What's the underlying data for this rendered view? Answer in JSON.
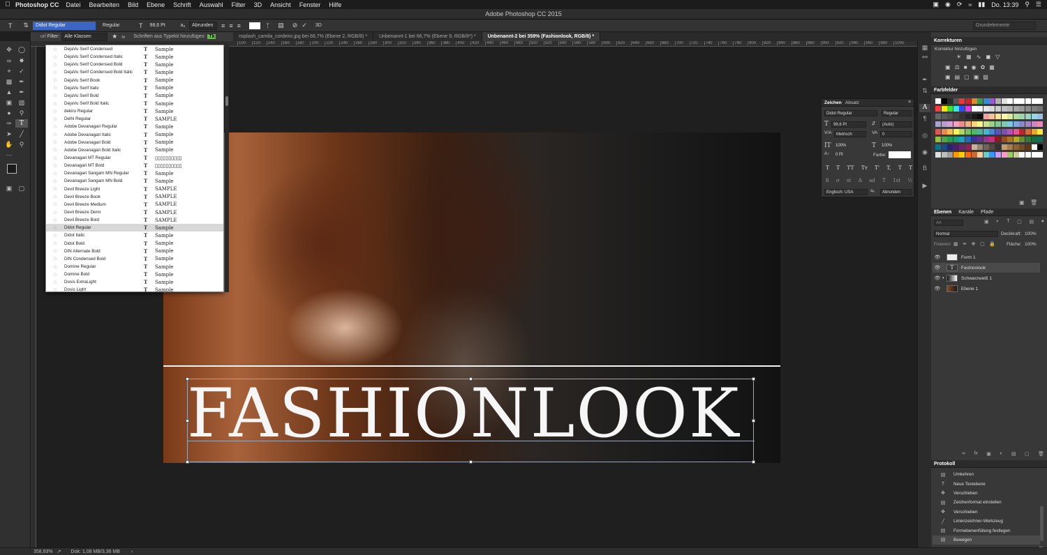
{
  "menubar": {
    "app": "Photoshop CC",
    "items": [
      "Datei",
      "Bearbeiten",
      "Bild",
      "Ebene",
      "Schrift",
      "Auswahl",
      "Filter",
      "3D",
      "Ansicht",
      "Fenster",
      "Hilfe"
    ],
    "clock": "Do. 13:39"
  },
  "window_title": "Adobe Photoshop CC 2015",
  "options": {
    "font_family": "Didot Regular",
    "font_style": "Regular",
    "font_size": "98,6 Pt",
    "aa_label": "aₐ",
    "antialias": "Abrunden",
    "workspace": "Grundelemente"
  },
  "filterbar": {
    "label": "Filter:",
    "class_value": "Alle Klassen",
    "typekit_label": "Schriften aus Typekit hinzufügen:",
    "typekit_badge": "Tk",
    "left_clip": "url"
  },
  "tabs": [
    {
      "label": "nsplash_camila_cordeiro.jpg bei 66,7% (Ebene 2, RGB/8) *",
      "active": false
    },
    {
      "label": "Unbenannt-1 bei 66,7% (Ebene 9, RGB/8*) *",
      "active": false
    },
    {
      "label": "Unbenannt-2 bei 359% (Fashionlook, RGB/8) *",
      "active": true
    }
  ],
  "ruler_ticks": [
    "100",
    "120",
    "140",
    "160",
    "180",
    "200",
    "220",
    "240",
    "260",
    "280",
    "300",
    "320",
    "340",
    "360",
    "380",
    "400",
    "420",
    "440",
    "460",
    "480",
    "500",
    "520",
    "540",
    "560",
    "580",
    "600",
    "620",
    "640",
    "660",
    "680",
    "700",
    "720",
    "740",
    "760",
    "780",
    "800",
    "820",
    "840",
    "860",
    "880",
    "900",
    "920",
    "940",
    "960",
    "980",
    "1000"
  ],
  "canvas": {
    "headline": "FASHIONLOOK"
  },
  "font_list": [
    {
      "name": "DejaVu Serif Condensed",
      "sample": "Sample"
    },
    {
      "name": "DejaVu Serif Condensed Italic",
      "sample": "Sample"
    },
    {
      "name": "DejaVu Serif Condensed Bold",
      "sample": "Sample"
    },
    {
      "name": "DejaVu Serif Condensed Bold Italic",
      "sample": "Sample"
    },
    {
      "name": "DejaVu Serif Book",
      "sample": "Sample"
    },
    {
      "name": "DejaVu Serif Italic",
      "sample": "Sample"
    },
    {
      "name": "DejaVu Serif Bold",
      "sample": "Sample"
    },
    {
      "name": "DejaVu Serif Bold Italic",
      "sample": "Sample"
    },
    {
      "name": "dekiru  Regular",
      "sample": "Sample"
    },
    {
      "name": "Delhi Regular",
      "sample": "SAMPLE"
    },
    {
      "name": "Adobe Devanagari Regular",
      "sample": "Sample"
    },
    {
      "name": "Adobe Devanagari Italic",
      "sample": "Sample"
    },
    {
      "name": "Adobe Devanagari Bold",
      "sample": "Sample"
    },
    {
      "name": "Adobe Devanagari Bold Italic",
      "sample": "Sample"
    },
    {
      "name": "Devanagari MT Regular",
      "sample": "▯▯▯▯▯▯▯▯▯▯"
    },
    {
      "name": "Devanagari MT Bold",
      "sample": "▯▯▯▯▯▯▯▯▯▯"
    },
    {
      "name": "Devanagari Sangam MN Regular",
      "sample": "Sample"
    },
    {
      "name": "Devanagari Sangam MN Bold",
      "sample": "Sample"
    },
    {
      "name": "Devil Breeze Light",
      "sample": "SAMPLE"
    },
    {
      "name": "Devil Breeze Book",
      "sample": "SAMPLE"
    },
    {
      "name": "Devil Breeze Medium",
      "sample": "SAMPLE"
    },
    {
      "name": "Devil Breeze Demi",
      "sample": "SAMPLE"
    },
    {
      "name": "Devil Breeze Bold",
      "sample": "SAMPLE"
    },
    {
      "name": "Didot Regular",
      "sample": "Sample",
      "selected": true
    },
    {
      "name": "Didot Italic",
      "sample": "Sample"
    },
    {
      "name": "Didot Bold",
      "sample": "Sample"
    },
    {
      "name": "DIN Alternate Bold",
      "sample": "Sample"
    },
    {
      "name": "DIN Condensed Bold",
      "sample": "Sample"
    },
    {
      "name": "Domine Regular",
      "sample": "Sample"
    },
    {
      "name": "Domine Bold",
      "sample": "Sample"
    },
    {
      "name": "Dosis ExtraLight",
      "sample": "Sample"
    },
    {
      "name": "Dosis Light",
      "sample": "Sample"
    }
  ],
  "korrekturen": {
    "tab": "Korrekturen",
    "subtitle": "Korrektur hinzufügen"
  },
  "farbfelder": {
    "tab": "Farbfelder",
    "colors": [
      "#ffffff",
      "#000000",
      "#2a2a2a",
      "#555555",
      "#e23a3a",
      "#c6262e",
      "#d98a2b",
      "#3a9a4a",
      "#2d8fd6",
      "#9a5bd0",
      "#b0b0b0",
      "#e0e0e0",
      "#ffffff",
      "#ffffff",
      "#ffffff",
      "#ffffff",
      "#ffffff",
      "#ffffff",
      "#ff3b3b",
      "#ffe600",
      "#38e038",
      "#39e6e6",
      "#2b4bff",
      "#e33be3",
      "#ffffff",
      "#f2f2f2",
      "#e6e6e6",
      "#d9d9d9",
      "#cccccc",
      "#bfbfbf",
      "#b3b3b3",
      "#a6a6a6",
      "#999999",
      "#8c8c8c",
      "#808080",
      "#737373",
      "#666666",
      "#595959",
      "#4d4d4d",
      "#404040",
      "#333333",
      "#262626",
      "#1a1a1a",
      "#0d0d0d",
      "#f2a0a0",
      "#f6c29b",
      "#fae29b",
      "#fff7a3",
      "#d7eca1",
      "#b3dca2",
      "#9fd5a8",
      "#9ad4c3",
      "#98d5e6",
      "#9cc0e8",
      "#a5a3d6",
      "#b89cd1",
      "#d4a1d1",
      "#f0a2c5",
      "#f08a8a",
      "#f4ad7c",
      "#f8d57c",
      "#fff58a",
      "#c7e28a",
      "#9bd18c",
      "#83c991",
      "#7ec9b1",
      "#7ccadf",
      "#80a9e0",
      "#8b87c9",
      "#a582c4",
      "#c886c4",
      "#eb88b3",
      "#e35454",
      "#ec8a4d",
      "#f2c14d",
      "#fff15a",
      "#b0d65a",
      "#74c25f",
      "#52b868",
      "#4ab894",
      "#44b9d3",
      "#4a87d3",
      "#5a55b6",
      "#7e50b0",
      "#b354b0",
      "#e25696",
      "#c4232b",
      "#d86a2c",
      "#e6a72d",
      "#fce83a",
      "#94c13f",
      "#4ea848",
      "#269f52",
      "#1e9f7a",
      "#1aa0c2",
      "#2469c0",
      "#3a3597",
      "#62308f",
      "#9b3490",
      "#c8317a",
      "#8c1b20",
      "#9d4c1f",
      "#a77a20",
      "#b8a82a",
      "#6a8c2c",
      "#357935",
      "#15703c",
      "#0f7058",
      "#0b718b",
      "#174b8a",
      "#27246c",
      "#461f67",
      "#6f2368",
      "#8f2158",
      "#c7b299",
      "#998675",
      "#736357",
      "#534741",
      "#37302d",
      "#c69c6d",
      "#a67c52",
      "#8c6239",
      "#754c24",
      "#603813",
      "#ffffff",
      "#000000",
      "#e0e0e0",
      "#bdbdbd",
      "#9e9e9e",
      "#ff9900",
      "#ffcc00",
      "#ff6600",
      "#cc6633",
      "#ffcc99",
      "#66cccc",
      "#3399ff",
      "#cc99ff",
      "#ff99cc",
      "#99cc66",
      "#cccc99",
      "#ffffff",
      "#ffffff",
      "#ffffff",
      "#ffffff"
    ]
  },
  "zeichen": {
    "tabs": [
      "Zeichen",
      "Absatz"
    ],
    "font": "Didot Regular",
    "style": "Regular",
    "size": "98,6 Pt",
    "leading": "(Auto)",
    "kerning": "Metrisch",
    "tracking": "0",
    "vscale": "100%",
    "hscale": "100%",
    "baseline": "0 Pt",
    "color_label": "Farbe:",
    "language": "Englisch: USA",
    "aa": "Abrunden",
    "aa_label": "aₐ",
    "type_buttons": [
      "T",
      "T",
      "TT",
      "Tт",
      "T'",
      "T,",
      "T",
      "T"
    ],
    "ot_buttons": [
      "fi",
      "σ",
      "st",
      "A",
      "ad",
      "T",
      "1st",
      "½"
    ]
  },
  "ebenen": {
    "tabs": [
      "Ebenen",
      "Kanäle",
      "Pfade"
    ],
    "filter_kind": "Art",
    "blend_mode": "Normal",
    "opacity_label": "Deckkraft:",
    "opacity": "100%",
    "lock_label": "Fixieren:",
    "fill_label": "Fläche:",
    "fill": "100%",
    "layers": [
      {
        "name": "Form 1",
        "selected": false
      },
      {
        "name": "Fashionlook",
        "selected": true
      },
      {
        "name": "Schwarzweiß 1",
        "selected": false
      },
      {
        "name": "Ebene 1",
        "selected": false
      }
    ]
  },
  "protokoll": {
    "tab": "Protokoll",
    "items": [
      {
        "name": "Umkehren",
        "selected": false
      },
      {
        "name": "Neue Textebene",
        "selected": false
      },
      {
        "name": "Verschieben",
        "selected": false
      },
      {
        "name": "Zeichenformat einstellen",
        "selected": false
      },
      {
        "name": "Verschieben",
        "selected": false
      },
      {
        "name": "Linienzeichner-Werkzeug",
        "selected": false
      },
      {
        "name": "Formebenenfüllung festlegen",
        "selected": false
      },
      {
        "name": "Bewegen",
        "selected": true
      }
    ]
  },
  "status": {
    "zoom": "358,93%",
    "doc": "Dok: 1,08 MB/3,36 MB"
  }
}
